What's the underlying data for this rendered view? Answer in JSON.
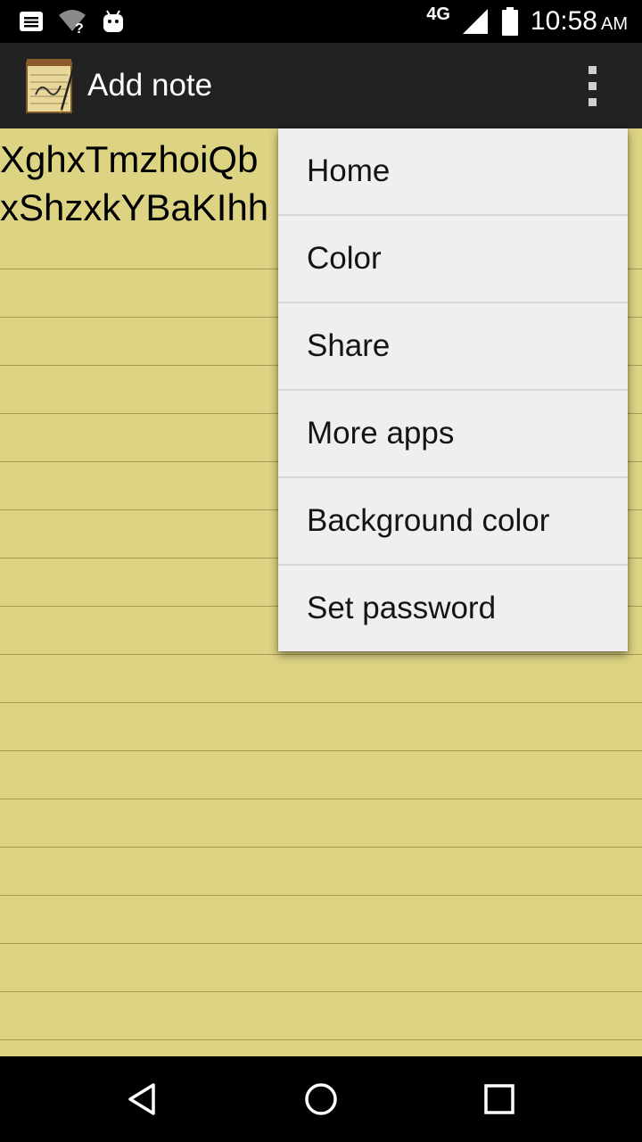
{
  "status_bar": {
    "network": "4G",
    "time": "10:58",
    "ampm": "AM",
    "icons": [
      "notification-icon",
      "wifi-unknown-icon",
      "android-debug-icon",
      "signal-icon",
      "battery-icon"
    ]
  },
  "action_bar": {
    "title": "Add note",
    "app_icon": "notepad-icon",
    "overflow_icon": "more-vertical-icon",
    "background": "#222222"
  },
  "note": {
    "text_line_1": "XghxTmzhoiQb",
    "text_line_2": "xShzxkYBaKIhh",
    "paper_color": "#dcd383",
    "line_color": "#a89c55"
  },
  "menu": {
    "items": [
      {
        "label": "Home"
      },
      {
        "label": "Color"
      },
      {
        "label": "Share"
      },
      {
        "label": "More apps"
      },
      {
        "label": "Background color"
      },
      {
        "label": "Set password"
      }
    ]
  },
  "nav_bar": {
    "icons": [
      "back-icon",
      "home-icon",
      "recents-icon"
    ]
  }
}
